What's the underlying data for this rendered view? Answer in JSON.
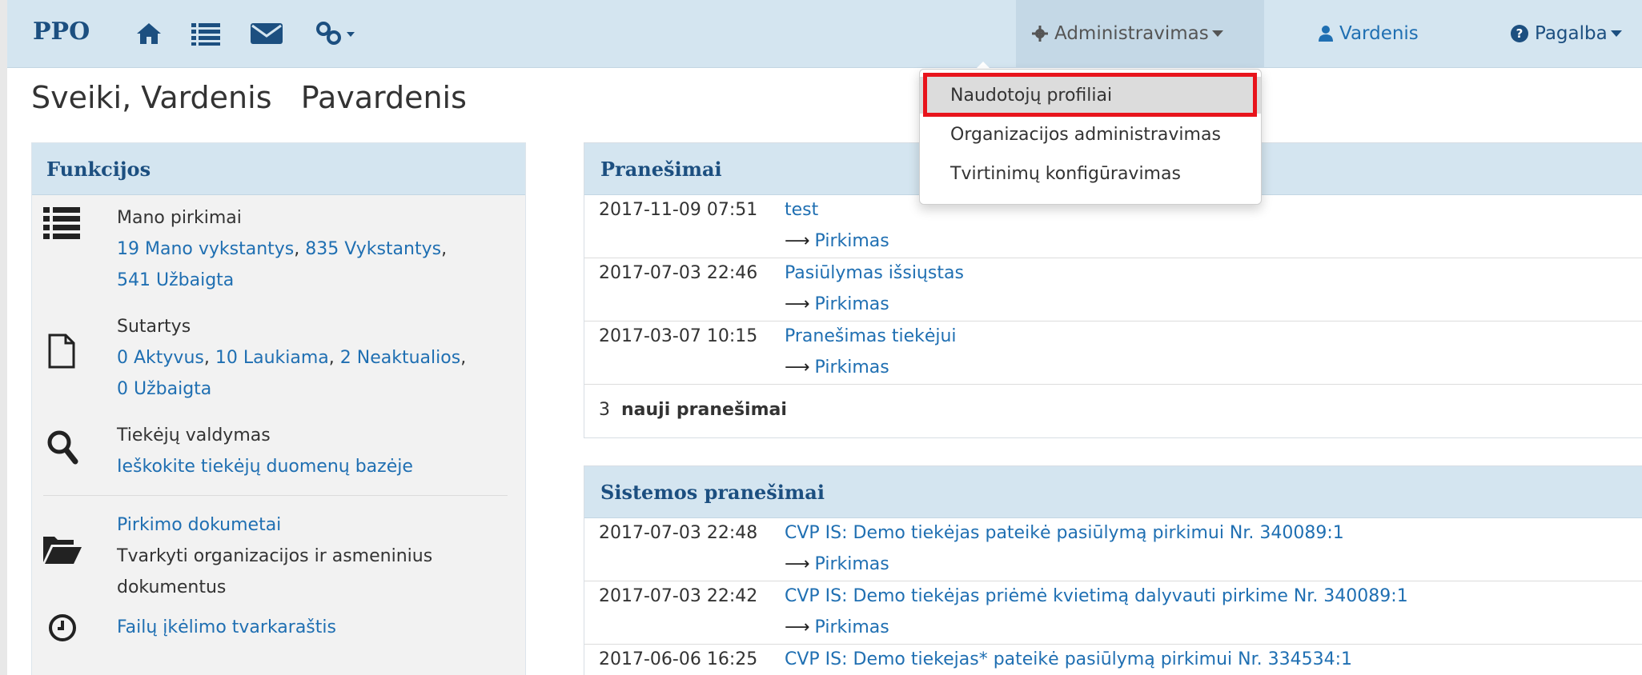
{
  "navbar": {
    "brand": "PPO",
    "icons": [
      "home-icon",
      "list-icon",
      "envelope-icon",
      "link-icon"
    ],
    "admin_label": "Administravimas",
    "user_label": "Vardenis",
    "help_label": "Pagalba"
  },
  "greeting": {
    "text": "Sveiki, Vardenis   Pavardenis"
  },
  "admin_menu": {
    "items": [
      {
        "label": "Naudotojų profiliai"
      },
      {
        "label": "Organizacijos administravimas"
      },
      {
        "label": "Tvirtinimų konfigūravimas"
      }
    ]
  },
  "functions": {
    "title": "Funkcijos",
    "purchases": {
      "title": "Mano pirkimai",
      "links": [
        "19 Mano vykstantys",
        "835 Vykstantys",
        "541 Užbaigta"
      ]
    },
    "contracts": {
      "title": "Sutartys",
      "links": [
        "0 Aktyvus",
        "10 Laukiama",
        "2 Neaktualios",
        "0 Užbaigta"
      ]
    },
    "suppliers": {
      "title": "Tiekėjų valdymas",
      "link": "Ieškokite tiekėjų duomenų bazėje"
    },
    "documents": {
      "link": "Pirkimo dokumetai",
      "text": "Tvarkyti organizacijos ir asmeninius dokumentus"
    },
    "schedule": {
      "link": "Failų įkėlimo tvarkaraštis"
    }
  },
  "notifications": {
    "title": "Pranešimai",
    "rows": [
      {
        "date": "2017-11-09 07:51",
        "message": "test",
        "sub": "Pirkimas"
      },
      {
        "date": "2017-07-03 22:46",
        "message": "Pasiūlymas išsiųstas",
        "sub": "Pirkimas"
      },
      {
        "date": "2017-03-07 10:15",
        "message": "Pranešimas tiekėjui",
        "sub": "Pirkimas"
      }
    ],
    "count_number": "3",
    "count_label": "nauji pranešimai"
  },
  "system_notifications": {
    "title": "Sistemos pranešimai",
    "rows": [
      {
        "date": "2017-07-03 22:48",
        "message": "CVP IS: Demo tiekėjas pateikė pasiūlymą pirkimui Nr. 340089:1",
        "sub": "Pirkimas"
      },
      {
        "date": "2017-07-03 22:42",
        "message": "CVP IS: Demo tiekėjas priėmė kvietimą dalyvauti pirkime Nr. 340089:1",
        "sub": "Pirkimas"
      },
      {
        "date": "2017-06-06 16:25",
        "message": "CVP IS: Demo tiekejas* pateikė pasiūlymą pirkimui Nr. 334534:1",
        "sub": ""
      }
    ]
  },
  "colors": {
    "navbar_bg": "#d4e5f0",
    "link": "#1f6fb2",
    "brand": "#1c4f80",
    "highlight": "#e8141c"
  }
}
